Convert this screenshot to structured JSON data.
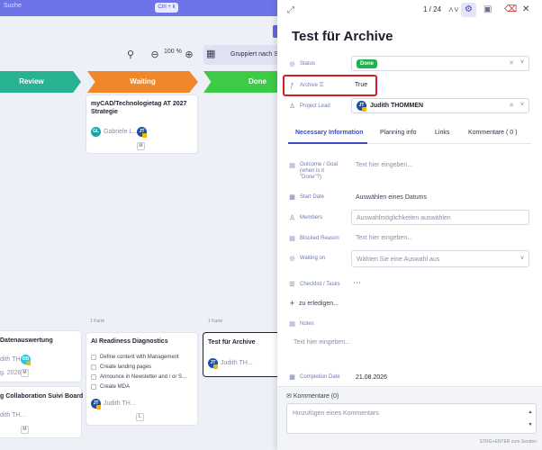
{
  "board": {
    "search_placeholder": "Suche",
    "shortcut": "Ctrl + k",
    "zoom": "100 %",
    "group_label": "Gruppiert nach Status",
    "stages": [
      {
        "label": "Review",
        "color": "#27b291"
      },
      {
        "label": "Waiting",
        "color": "#f0882b"
      },
      {
        "label": "Done",
        "color": "#3dca47"
      }
    ],
    "waiting_card": {
      "title": "myCAD/Technologietag AT 2027 Strategie",
      "assignee_initials": "GL",
      "assignee_name": "Gabriele L...",
      "second_initials": "JT",
      "tag": "M"
    },
    "count_labels": [
      "1 Karte",
      "1 Karte"
    ],
    "review_card1": {
      "title": "Datenauswertung",
      "person": "dith TH...",
      "initials": "DB",
      "date": "g. 2026",
      "tag": "M"
    },
    "review_card2": {
      "title": "g Collaboration Suivi Board",
      "person": "dith TH...",
      "tag": "M"
    },
    "ai_card": {
      "title": "AI Readiness Diagnostics",
      "checklist": [
        "Define content with Management",
        "Create landing pages",
        "Announce in Newsletter and / or S...",
        "Create MDA"
      ],
      "initials": "JT",
      "person": "Judith TH...",
      "tag": "L"
    },
    "archive_card": {
      "title": "Test für Archive",
      "initials": "JT",
      "person": "Judith TH..."
    }
  },
  "panel": {
    "pager": "1 / 24",
    "title": "Test für Archive",
    "fields": {
      "status_label": "Status",
      "status_value": "Done",
      "archive_label": "Archive",
      "archive_value": "True",
      "lead_label": "Project Lead",
      "lead_initials": "JT",
      "lead_value": "Judith THOMMEN"
    },
    "tabs": [
      "Necessary Information",
      "Planning info",
      "Links",
      "Kommentare ( 0 )"
    ],
    "info": {
      "outcome_label": "Outcome / Goal (when is it \"Done\"?)",
      "outcome_placeholder": "Text hier eingeben...",
      "start_label": "Start Date",
      "start_placeholder": "Auswählen eines Datums",
      "members_label": "Members",
      "members_placeholder": "Auswahlmöglichkeiten auswählen",
      "blocked_label": "Blocked Reason",
      "blocked_placeholder": "Text hier eingeben...",
      "waiting_label": "Waiting on",
      "waiting_placeholder": "Wählen Sie eine Auswahl aus",
      "checklist_label": "Checklist / Tasks",
      "add_todo": "zu erledigen...",
      "notes_label": "Notes",
      "notes_placeholder": "Text hier eingeben...",
      "completion_label": "Completion Date",
      "completion_value": "21.08.2026"
    },
    "comments": {
      "header": "Kommentare (0)",
      "placeholder": "Hinzufügen eines Kommentars",
      "hint": "STRG+ENTER zum Senden"
    }
  }
}
